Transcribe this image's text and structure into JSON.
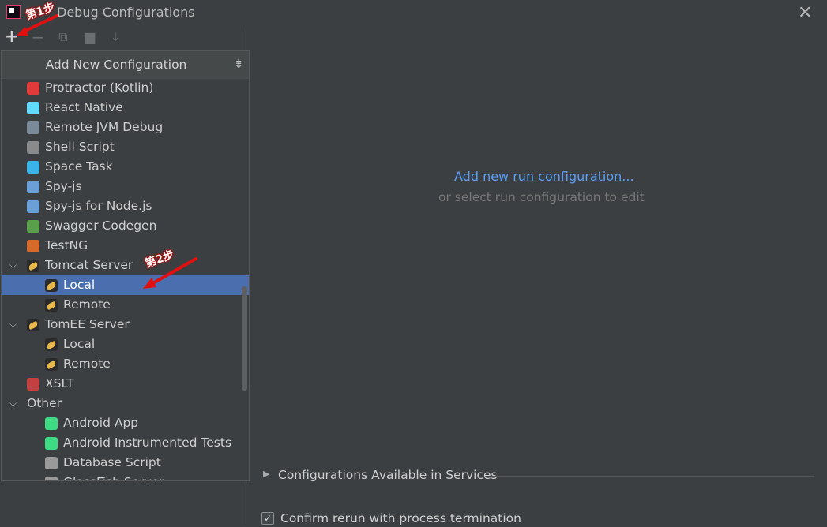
{
  "window": {
    "title": "Debug Configurations",
    "close_glyph": "✕"
  },
  "toolbar": {
    "add_glyph": "+",
    "remove_glyph": "−",
    "copy_glyph": "⧉",
    "folder_glyph": "▆",
    "sort_glyph": "↓"
  },
  "popup": {
    "title": "Add New Configuration",
    "collapse_glyph": "⇟",
    "items": [
      {
        "label": "Protractor (Kotlin)",
        "icon": "protractor-icon",
        "color": "#e03a3a"
      },
      {
        "label": "React Native",
        "icon": "react-icon",
        "color": "#61dafb"
      },
      {
        "label": "Remote JVM Debug",
        "icon": "remote-debug-icon",
        "color": "#7a8a99"
      },
      {
        "label": "Shell Script",
        "icon": "shell-icon",
        "color": "#8a8a8a"
      },
      {
        "label": "Space Task",
        "icon": "space-icon",
        "color": "#3bb3e8"
      },
      {
        "label": "Spy-js",
        "icon": "spy-icon",
        "color": "#6a9fd8"
      },
      {
        "label": "Spy-js for Node.js",
        "icon": "spy-node-icon",
        "color": "#6a9fd8"
      },
      {
        "label": "Swagger Codegen",
        "icon": "swagger-icon",
        "color": "#5aa04a"
      },
      {
        "label": "TestNG",
        "icon": "testng-icon",
        "color": "#d66a2b"
      },
      {
        "label": "Tomcat Server",
        "icon": "tomcat-icon",
        "expanded": true
      },
      {
        "label": "Local",
        "icon": "tomcat-local-icon",
        "selected": true
      },
      {
        "label": "Remote",
        "icon": "tomcat-remote-icon"
      },
      {
        "label": "TomEE Server",
        "icon": "tomee-icon",
        "expanded": true
      },
      {
        "label": "Local",
        "icon": "tomee-local-icon"
      },
      {
        "label": "Remote",
        "icon": "tomee-remote-icon"
      },
      {
        "label": "XSLT",
        "icon": "xslt-icon",
        "color": "#c24040"
      },
      {
        "label": "Other",
        "icon": "",
        "expanded": true
      },
      {
        "label": "Android App",
        "icon": "android-icon",
        "color": "#3ddc84"
      },
      {
        "label": "Android Instrumented Tests",
        "icon": "android-test-icon",
        "color": "#3ddc84"
      },
      {
        "label": "Database Script",
        "icon": "database-icon",
        "color": "#9a9a9a"
      },
      {
        "label": "GlassFish Server",
        "icon": "glassfish-icon",
        "color": "#9a9a9a",
        "expanded": true
      }
    ]
  },
  "main": {
    "add_link": "Add new run configuration...",
    "hint": "or select run configuration to edit"
  },
  "services": {
    "label": "Configurations Available in Services"
  },
  "confirm": {
    "label": "Confirm rerun with process termination",
    "checked": true
  },
  "annotations": {
    "step1": "第1步",
    "step2": "第2步",
    "arrow_color": "#e01010"
  }
}
